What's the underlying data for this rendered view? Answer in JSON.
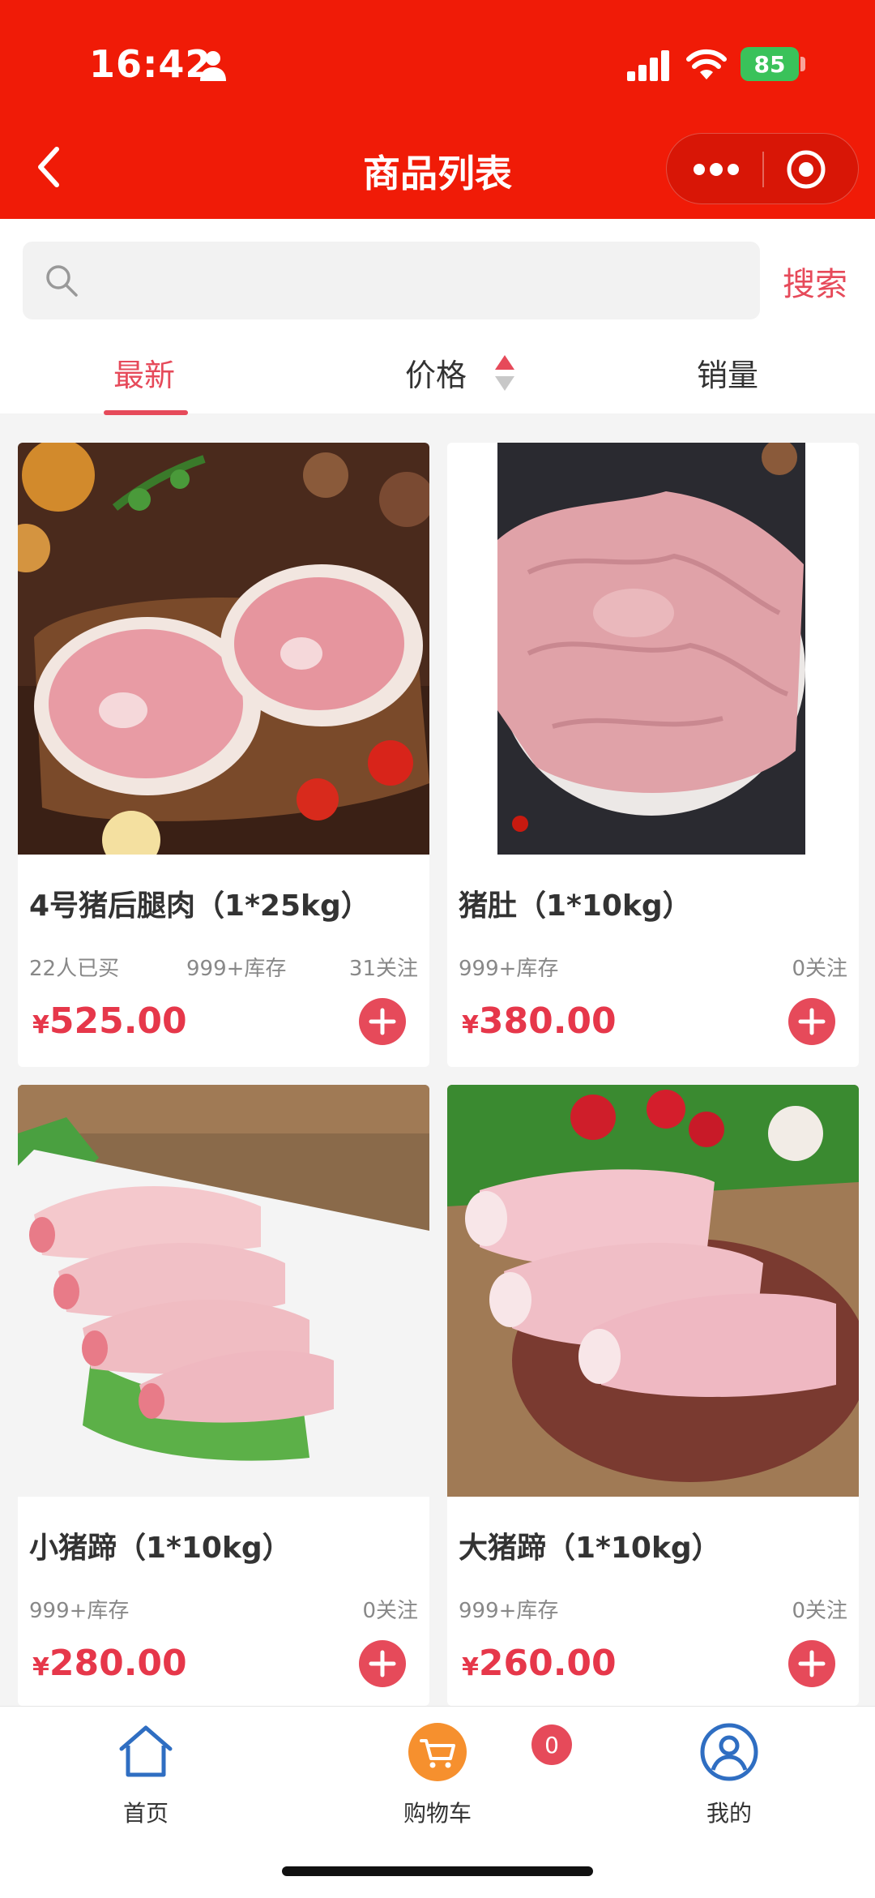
{
  "status_bar": {
    "time": "16:42",
    "battery": "85"
  },
  "nav": {
    "title": "商品列表"
  },
  "search": {
    "placeholder": "",
    "button_label": "搜索"
  },
  "sort_tabs": [
    {
      "label": "最新",
      "active": true
    },
    {
      "label": "价格",
      "active": false
    },
    {
      "label": "销量",
      "active": false
    }
  ],
  "products": [
    {
      "name": "4号猪后腿肉（1*25kg）",
      "bought": "22人已买",
      "stock": "999+库存",
      "follows": "31关注",
      "currency": "¥",
      "price": "525.00"
    },
    {
      "name": "猪肚（1*10kg）",
      "stock": "999+库存",
      "follows": "0关注",
      "currency": "¥",
      "price": "380.00"
    },
    {
      "name": "小猪蹄（1*10kg）",
      "stock": "999+库存",
      "follows": "0关注",
      "currency": "¥",
      "price": "280.00"
    },
    {
      "name": "大猪蹄（1*10kg）",
      "stock": "999+库存",
      "follows": "0关注",
      "currency": "¥",
      "price": "260.00"
    }
  ],
  "tabbar": {
    "home_label": "首页",
    "cart_label": "购物车",
    "cart_count": "0",
    "me_label": "我的"
  },
  "colors": {
    "header": "#f01b07",
    "accent": "#e64a5a",
    "price": "#e6374a"
  }
}
